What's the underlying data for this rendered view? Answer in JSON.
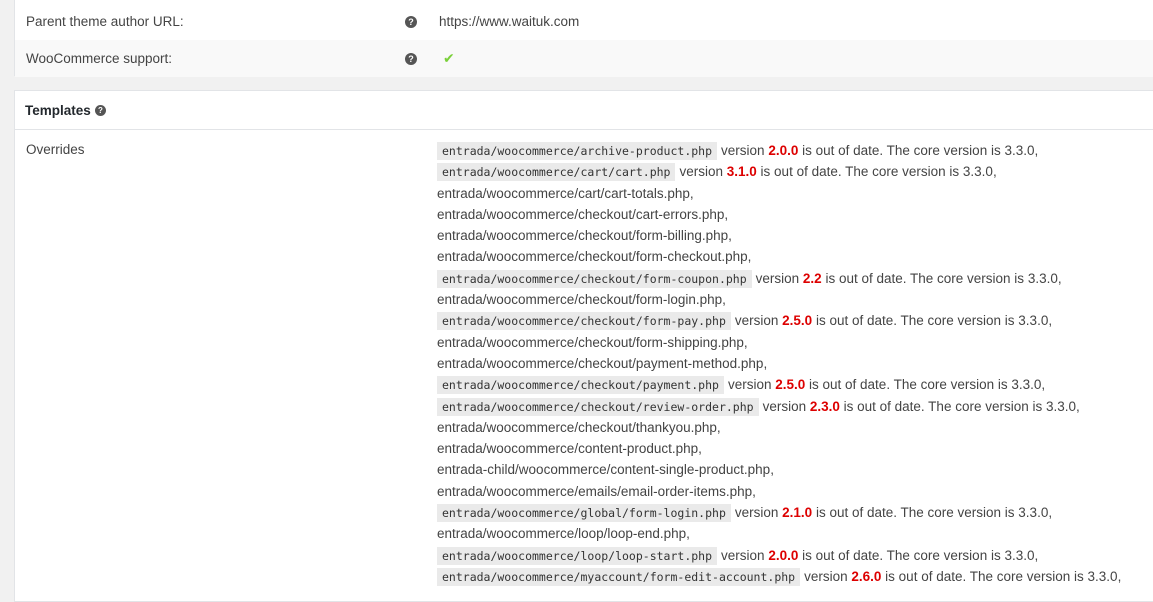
{
  "theme": {
    "rows": [
      {
        "label": "Parent theme author URL:",
        "value": "https://www.waituk.com"
      },
      {
        "label": "WooCommerce support:",
        "value": "✔"
      }
    ]
  },
  "templates": {
    "title": "Templates",
    "overrides_label": "Overrides",
    "items": [
      {
        "path": "entrada/woocommerce/archive-product.php",
        "version": "2.0.0",
        "core": "3.3.0"
      },
      {
        "path": "entrada/woocommerce/cart/cart.php",
        "version": "3.1.0",
        "core": "3.3.0"
      },
      {
        "path": "entrada/woocommerce/cart/cart-totals.php"
      },
      {
        "path": "entrada/woocommerce/checkout/cart-errors.php"
      },
      {
        "path": "entrada/woocommerce/checkout/form-billing.php"
      },
      {
        "path": "entrada/woocommerce/checkout/form-checkout.php"
      },
      {
        "path": "entrada/woocommerce/checkout/form-coupon.php",
        "version": "2.2",
        "core": "3.3.0"
      },
      {
        "path": "entrada/woocommerce/checkout/form-login.php"
      },
      {
        "path": "entrada/woocommerce/checkout/form-pay.php",
        "version": "2.5.0",
        "core": "3.3.0"
      },
      {
        "path": "entrada/woocommerce/checkout/form-shipping.php"
      },
      {
        "path": "entrada/woocommerce/checkout/payment-method.php"
      },
      {
        "path": "entrada/woocommerce/checkout/payment.php",
        "version": "2.5.0",
        "core": "3.3.0"
      },
      {
        "path": "entrada/woocommerce/checkout/review-order.php",
        "version": "2.3.0",
        "core": "3.3.0"
      },
      {
        "path": "entrada/woocommerce/checkout/thankyou.php"
      },
      {
        "path": "entrada/woocommerce/content-product.php"
      },
      {
        "path": "entrada-child/woocommerce/content-single-product.php"
      },
      {
        "path": "entrada/woocommerce/emails/email-order-items.php"
      },
      {
        "path": "entrada/woocommerce/global/form-login.php",
        "version": "2.1.0",
        "core": "3.3.0"
      },
      {
        "path": "entrada/woocommerce/loop/loop-end.php"
      },
      {
        "path": "entrada/woocommerce/loop/loop-start.php",
        "version": "2.0.0",
        "core": "3.3.0"
      },
      {
        "path": "entrada/woocommerce/myaccount/form-edit-account.php",
        "version": "2.6.0",
        "core": "3.3.0"
      }
    ]
  }
}
